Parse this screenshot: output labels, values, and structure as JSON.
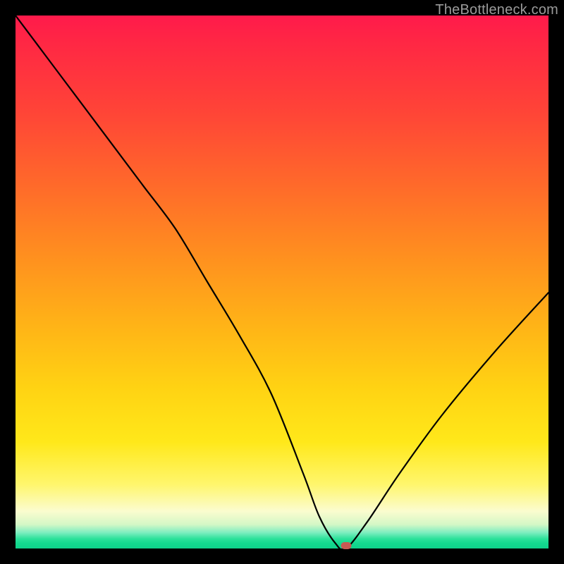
{
  "watermark": "TheBottleneck.com",
  "marker": {
    "color": "#c65a53"
  },
  "chart_data": {
    "type": "line",
    "title": "",
    "xlabel": "",
    "ylabel": "",
    "xlim": [
      0,
      100
    ],
    "ylim": [
      0,
      100
    ],
    "series": [
      {
        "name": "bottleneck-curve",
        "x": [
          0,
          6,
          12,
          18,
          24,
          30,
          36,
          42,
          48,
          54,
          57,
          60,
          62,
          66,
          72,
          80,
          90,
          100
        ],
        "values": [
          100,
          92,
          84,
          76,
          68,
          60,
          50,
          40,
          29,
          14,
          6,
          1,
          0,
          5,
          14,
          25,
          37,
          48
        ]
      }
    ],
    "marker_point": {
      "x": 62,
      "y": 0.5
    },
    "annotations": []
  }
}
